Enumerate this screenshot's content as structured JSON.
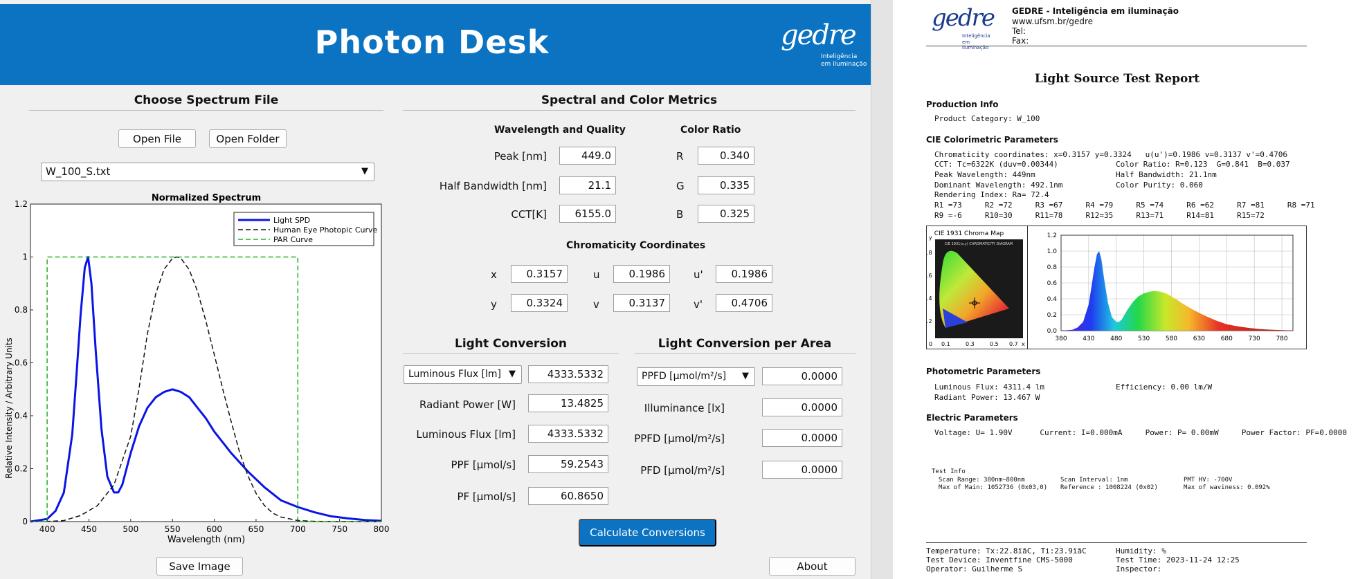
{
  "header": {
    "title": "Photon Desk",
    "logo_text": "gedre",
    "logo_tag_1": "Inteligência",
    "logo_tag_2": "em iluminação"
  },
  "file_panel": {
    "title": "Choose Spectrum File",
    "open_file": "Open File",
    "open_folder": "Open Folder",
    "selected_file": "W_100_S.txt",
    "save_image": "Save Image"
  },
  "chart_data": {
    "type": "line",
    "title": "Normalized Spectrum",
    "xlabel": "Wavelength (nm)",
    "ylabel": "Relative Intensity / Arbitrary Units",
    "xlim": [
      380,
      800
    ],
    "ylim": [
      0,
      1.2
    ],
    "x_ticks": [
      "400",
      "450",
      "500",
      "550",
      "600",
      "650",
      "700",
      "750",
      "800"
    ],
    "y_ticks": [
      "0",
      "0.2",
      "0.4",
      "0.6",
      "0.8",
      "1",
      "1.2"
    ],
    "grid": "minor",
    "legend_position": "top-right",
    "series": [
      {
        "name": "Light SPD",
        "color": "#0a14e6",
        "style": "solid",
        "x": [
          380,
          400,
          410,
          420,
          430,
          435,
          440,
          445,
          449,
          453,
          458,
          465,
          472,
          480,
          485,
          490,
          495,
          500,
          510,
          520,
          530,
          540,
          550,
          560,
          570,
          580,
          590,
          600,
          620,
          640,
          660,
          680,
          700,
          720,
          740,
          760,
          780,
          800
        ],
        "y": [
          0.0,
          0.01,
          0.04,
          0.11,
          0.33,
          0.55,
          0.78,
          0.96,
          1.0,
          0.9,
          0.65,
          0.35,
          0.17,
          0.11,
          0.11,
          0.14,
          0.2,
          0.26,
          0.36,
          0.43,
          0.47,
          0.49,
          0.5,
          0.49,
          0.47,
          0.43,
          0.39,
          0.34,
          0.26,
          0.19,
          0.13,
          0.08,
          0.055,
          0.035,
          0.02,
          0.012,
          0.006,
          0.003
        ]
      },
      {
        "name": "Human Eye Photopic Curve",
        "color": "#111111",
        "style": "dashed",
        "x": [
          380,
          400,
          420,
          440,
          460,
          480,
          500,
          510,
          520,
          530,
          540,
          550,
          555,
          560,
          570,
          580,
          590,
          600,
          610,
          620,
          630,
          640,
          650,
          660,
          670,
          680,
          700,
          720,
          750,
          800
        ],
        "y": [
          0.0,
          0.0004,
          0.004,
          0.023,
          0.06,
          0.139,
          0.323,
          0.503,
          0.71,
          0.862,
          0.954,
          0.995,
          1.0,
          0.995,
          0.952,
          0.87,
          0.757,
          0.631,
          0.503,
          0.381,
          0.265,
          0.175,
          0.107,
          0.061,
          0.032,
          0.017,
          0.004,
          0.001,
          0.0,
          0.0
        ]
      },
      {
        "name": "PAR Curve",
        "color": "#22b022",
        "style": "dashed",
        "x": [
          380,
          400,
          400,
          700,
          700,
          800
        ],
        "y": [
          0,
          0,
          1,
          1,
          0,
          0
        ]
      }
    ]
  },
  "metrics": {
    "title": "Spectral and Color Metrics",
    "wq_title": "Wavelength and Quality",
    "cr_title": "Color Ratio",
    "peak_label": "Peak [nm]",
    "peak": "449.0",
    "hbw_label": "Half Bandwidth [nm]",
    "hbw": "21.1",
    "cct_label": "CCT[K]",
    "cct": "6155.0",
    "r_label": "R",
    "r": "0.340",
    "g_label": "G",
    "g": "0.335",
    "b_label": "B",
    "b": "0.325",
    "chroma_title": "Chromaticity Coordinates",
    "x_label": "x",
    "x": "0.3157",
    "y_label": "y",
    "y": "0.3324",
    "u_label": "u",
    "u": "0.1986",
    "v_label": "v",
    "v": "0.3137",
    "up_label": "u'",
    "up": "0.1986",
    "vp_label": "v'",
    "vp": "0.4706"
  },
  "conversion": {
    "title": "Light Conversion",
    "select": "Luminous Flux [lm]",
    "select_value": "4333.5332",
    "radiant_label": "Radiant Power [W]",
    "radiant": "13.4825",
    "flux_label": "Luminous Flux [lm]",
    "flux": "4333.5332",
    "ppf_label": "PPF [µmol/s]",
    "ppf": "59.2543",
    "pf_label": "PF [µmol/s]",
    "pf": "60.8650",
    "calc_button": "Calculate Conversions"
  },
  "area": {
    "title": "Light Conversion per Area",
    "select": "PPFD [µmol/m²/s]",
    "select_value": "0.0000",
    "illum_label": "Illuminance [lx]",
    "illum": "0.0000",
    "ppfd_label": "PPFD [µmol/m²/s]",
    "ppfd": "0.0000",
    "pfd_label": "PFD [µmol/m²/s]",
    "pfd": "0.0000",
    "about": "About"
  },
  "report": {
    "org_name": "GEDRE - Inteligência em iluminação",
    "org_url": "www.ufsm.br/gedre",
    "org_tel": "Tel:",
    "org_fax": "Fax:",
    "title": "Light Source Test Report",
    "prod_title": "Production Info",
    "prod_cat": "Product Category: W_100",
    "cie_title": "CIE Colorimetric Parameters",
    "cie_l1": "Chromaticity coordinates: x=0.3157 y=0.3324   u(u')=0.1986 v=0.3137 v'=0.4706",
    "cie_l2a": "CCT: Tc=6322K (duv=0.00344)",
    "cie_l2b": "Color Ratio: R=0.123  G=0.841  B=0.037",
    "cie_l3a": "Peak Wavelength: 449nm",
    "cie_l3b": "Half Bandwidth: 21.1nm",
    "cie_l4a": "Dominant Wavelength: 492.1nm",
    "cie_l4b": "Color Purity: 0.060",
    "cie_l5": "Rendering Index: Ra= 72.4",
    "cie_l6": "R1 =73     R2 =72     R3 =67     R4 =79     R5 =74     R6 =62     R7 =81     R8 =71",
    "cie_l7": "R9 =-6     R10=30     R11=78     R12=35     R13=71     R14=81     R15=72",
    "chroma_map_title": "CIE 1931 Chroma Map",
    "chroma_map_inner": "CIE 1931(x,y) CHROMATICITY DIAGRAM",
    "chroma_y_label": "y",
    "chroma_x_label": "x",
    "chroma_x_ticks": [
      "0",
      "0.1",
      "0.3",
      "0.5",
      "0.7"
    ],
    "chroma_y_ticks": [
      ".8",
      ".6",
      ".4",
      ".2"
    ],
    "spec_y_ticks": [
      "1.2",
      "1.0",
      "0.8",
      "0.6",
      "0.4",
      "0.2",
      "0.0"
    ],
    "spec_x_ticks": [
      "380",
      "430",
      "480",
      "530",
      "580",
      "630",
      "680",
      "730",
      "780"
    ],
    "photo_title": "Photometric Parameters",
    "photo_l1a": "Luminous Flux: 4311.4 lm",
    "photo_l1b": "Efficiency: 0.00 lm/W",
    "photo_l2": "Radiant Power: 13.467 W",
    "elec_title": "Electric Parameters",
    "elec_l1": "Voltage: U= 1.90V      Current: I=0.000mA     Power: P= 0.00mW     Power Factor: PF=0.0000",
    "test_title": "Test Info",
    "test_l1a": "Scan Range: 380nm~800nm",
    "test_l1b": "Scan Interval: 1nm",
    "test_l1c": "PMT HV: -700V",
    "test_l2a": "Max of Main: 1052736 (0x03,0)",
    "test_l2b": "Reference : 1008224 (0x02)",
    "test_l2c": "Max of waviness: 0.092%",
    "foot_l1a": "Temperature: Tx:22.8ïãC, Ti:23.9ïãC",
    "foot_l1b": "Humidity: %",
    "foot_l2a": "Test Device: Inventfine CMS-5000",
    "foot_l2b": "Test Time: 2023-11-24 12:25",
    "foot_l3a": "Operator: Guilherme S",
    "foot_l3b": "Inspector:"
  }
}
